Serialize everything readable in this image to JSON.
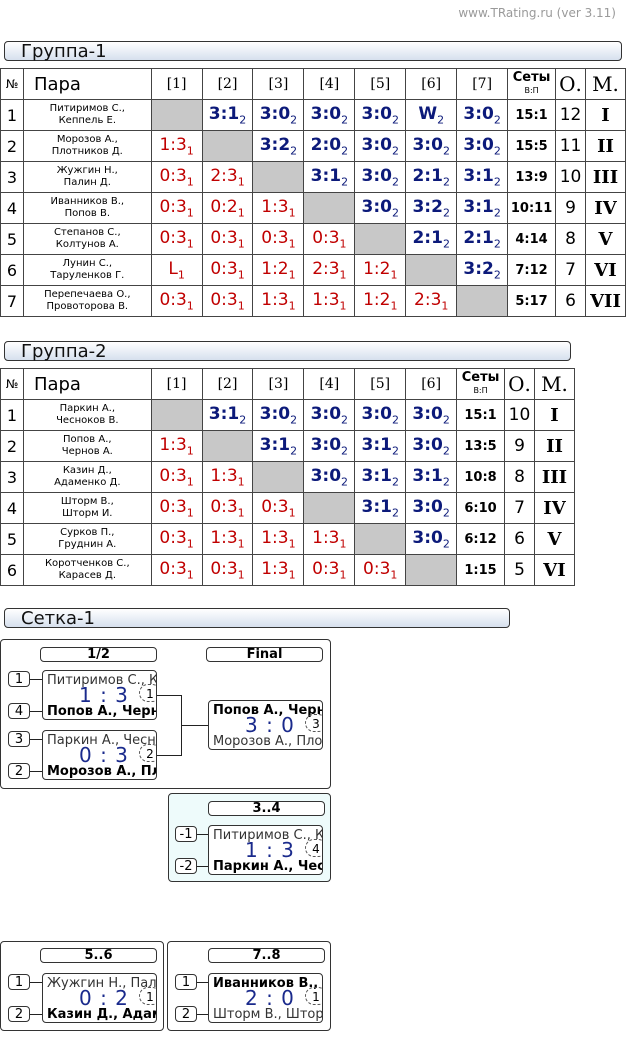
{
  "watermark": "www.TRating.ru (ver 3.11)",
  "headers": {
    "no": "№",
    "pair": "Пара",
    "sets": "Сеты",
    "sets_sub": "В:П",
    "points": "О.",
    "place": "М."
  },
  "group1": {
    "title": "Группа-1",
    "cols": [
      "[1]",
      "[2]",
      "[3]",
      "[4]",
      "[5]",
      "[6]",
      "[7]"
    ],
    "rows": [
      {
        "n": "1",
        "a": "Питиримов С.,",
        "b": "Кеппель Е.",
        "cells": [
          [
            "",
            ""
          ],
          [
            "3:1",
            "2"
          ],
          [
            "3:0",
            "2"
          ],
          [
            "3:0",
            "2"
          ],
          [
            "3:0",
            "2"
          ],
          [
            "W",
            "2"
          ],
          [
            "3:0",
            "2"
          ]
        ],
        "sets": "15:1",
        "pts": "12",
        "place": "I"
      },
      {
        "n": "2",
        "a": "Морозов А.,",
        "b": "Плотников Д.",
        "cells": [
          [
            "1:3",
            "1"
          ],
          [
            "",
            ""
          ],
          [
            "3:2",
            "2"
          ],
          [
            "2:0",
            "2"
          ],
          [
            "3:0",
            "2"
          ],
          [
            "3:0",
            "2"
          ],
          [
            "3:0",
            "2"
          ]
        ],
        "sets": "15:5",
        "pts": "11",
        "place": "II"
      },
      {
        "n": "3",
        "a": "Жужгин Н.,",
        "b": "Палин Д.",
        "cells": [
          [
            "0:3",
            "1"
          ],
          [
            "2:3",
            "1"
          ],
          [
            "",
            ""
          ],
          [
            "3:1",
            "2"
          ],
          [
            "3:0",
            "2"
          ],
          [
            "2:1",
            "2"
          ],
          [
            "3:1",
            "2"
          ]
        ],
        "sets": "13:9",
        "pts": "10",
        "place": "III"
      },
      {
        "n": "4",
        "a": "Иванников В.,",
        "b": "Попов В.",
        "cells": [
          [
            "0:3",
            "1"
          ],
          [
            "0:2",
            "1"
          ],
          [
            "1:3",
            "1"
          ],
          [
            "",
            ""
          ],
          [
            "3:0",
            "2"
          ],
          [
            "3:2",
            "2"
          ],
          [
            "3:1",
            "2"
          ]
        ],
        "sets": "10:11",
        "pts": "9",
        "place": "IV"
      },
      {
        "n": "5",
        "a": "Степанов С.,",
        "b": "Колтунов А.",
        "cells": [
          [
            "0:3",
            "1"
          ],
          [
            "0:3",
            "1"
          ],
          [
            "0:3",
            "1"
          ],
          [
            "0:3",
            "1"
          ],
          [
            "",
            ""
          ],
          [
            "2:1",
            "2"
          ],
          [
            "2:1",
            "2"
          ]
        ],
        "sets": "4:14",
        "pts": "8",
        "place": "V"
      },
      {
        "n": "6",
        "a": "Лунин С.,",
        "b": "Таруленков Г.",
        "cells": [
          [
            "L",
            "1"
          ],
          [
            "0:3",
            "1"
          ],
          [
            "1:2",
            "1"
          ],
          [
            "2:3",
            "1"
          ],
          [
            "1:2",
            "1"
          ],
          [
            "",
            ""
          ],
          [
            "3:2",
            "2"
          ]
        ],
        "sets": "7:12",
        "pts": "7",
        "place": "VI"
      },
      {
        "n": "7",
        "a": "Перепечаева О.,",
        "b": "Провоторова В.",
        "cells": [
          [
            "0:3",
            "1"
          ],
          [
            "0:3",
            "1"
          ],
          [
            "1:3",
            "1"
          ],
          [
            "1:3",
            "1"
          ],
          [
            "1:2",
            "1"
          ],
          [
            "2:3",
            "1"
          ],
          [
            "",
            ""
          ]
        ],
        "sets": "5:17",
        "pts": "6",
        "place": "VII"
      }
    ]
  },
  "group2": {
    "title": "Группа-2",
    "cols": [
      "[1]",
      "[2]",
      "[3]",
      "[4]",
      "[5]",
      "[6]"
    ],
    "rows": [
      {
        "n": "1",
        "a": "Паркин А.,",
        "b": "Чесноков В.",
        "cells": [
          [
            "",
            ""
          ],
          [
            "3:1",
            "2"
          ],
          [
            "3:0",
            "2"
          ],
          [
            "3:0",
            "2"
          ],
          [
            "3:0",
            "2"
          ],
          [
            "3:0",
            "2"
          ]
        ],
        "sets": "15:1",
        "pts": "10",
        "place": "I"
      },
      {
        "n": "2",
        "a": "Попов А.,",
        "b": "Чернов А.",
        "cells": [
          [
            "1:3",
            "1"
          ],
          [
            "",
            ""
          ],
          [
            "3:1",
            "2"
          ],
          [
            "3:0",
            "2"
          ],
          [
            "3:1",
            "2"
          ],
          [
            "3:0",
            "2"
          ]
        ],
        "sets": "13:5",
        "pts": "9",
        "place": "II"
      },
      {
        "n": "3",
        "a": "Казин Д.,",
        "b": "Адаменко Д.",
        "cells": [
          [
            "0:3",
            "1"
          ],
          [
            "1:3",
            "1"
          ],
          [
            "",
            ""
          ],
          [
            "3:0",
            "2"
          ],
          [
            "3:1",
            "2"
          ],
          [
            "3:1",
            "2"
          ]
        ],
        "sets": "10:8",
        "pts": "8",
        "place": "III"
      },
      {
        "n": "4",
        "a": "Шторм В.,",
        "b": "Шторм И.",
        "cells": [
          [
            "0:3",
            "1"
          ],
          [
            "0:3",
            "1"
          ],
          [
            "0:3",
            "1"
          ],
          [
            "",
            ""
          ],
          [
            "3:1",
            "2"
          ],
          [
            "3:0",
            "2"
          ]
        ],
        "sets": "6:10",
        "pts": "7",
        "place": "IV"
      },
      {
        "n": "5",
        "a": "Сурков П.,",
        "b": "Груднин А.",
        "cells": [
          [
            "0:3",
            "1"
          ],
          [
            "1:3",
            "1"
          ],
          [
            "1:3",
            "1"
          ],
          [
            "1:3",
            "1"
          ],
          [
            "",
            ""
          ],
          [
            "3:0",
            "2"
          ]
        ],
        "sets": "6:12",
        "pts": "6",
        "place": "V"
      },
      {
        "n": "6",
        "a": "Коротченков С.,",
        "b": "Карасев Д.",
        "cells": [
          [
            "0:3",
            "1"
          ],
          [
            "0:3",
            "1"
          ],
          [
            "1:3",
            "1"
          ],
          [
            "0:3",
            "1"
          ],
          [
            "0:3",
            "1"
          ],
          [
            "",
            ""
          ]
        ],
        "sets": "1:15",
        "pts": "5",
        "place": "VI"
      }
    ]
  },
  "bracket": {
    "title": "Сетка-1",
    "semi_label": "1/2",
    "final_label": "Final",
    "third_label": "3..4",
    "fifth_label": "5..6",
    "seventh_label": "7..8",
    "semi1": {
      "seed1": "1",
      "seed2": "4",
      "p1": "Питиримов С., Кеппель Е.",
      "p2": "Попов А., Чернов А.",
      "score": "1 : 3",
      "num": "1"
    },
    "semi2": {
      "seed1": "3",
      "seed2": "2",
      "p1": "Паркин А., Чесноков В.",
      "p2": "Морозов А., Плотников Д.",
      "score": "0 : 3",
      "num": "2"
    },
    "final": {
      "p1": "Попов А., Чернов А.",
      "p2": "Морозов А., Плотников Д.",
      "score": "3 : 0",
      "num": "3"
    },
    "third": {
      "seed1": "-1",
      "seed2": "-2",
      "p1": "Питиримов С., Кеппель Е.",
      "p2": "Паркин А., Чесноков В.",
      "score": "1 : 3",
      "num": "4"
    },
    "fifth": {
      "seed1": "1",
      "seed2": "2",
      "p1": "Жужгин Н., Палин Д.",
      "p2": "Казин Д., Адаменко Д.",
      "score": "0 : 2",
      "num": "1"
    },
    "seventh": {
      "seed1": "1",
      "seed2": "2",
      "p1": "Иванников В., Попов В.",
      "p2": "Шторм В., Шторм И.",
      "score": "2 : 0",
      "num": "1"
    }
  }
}
